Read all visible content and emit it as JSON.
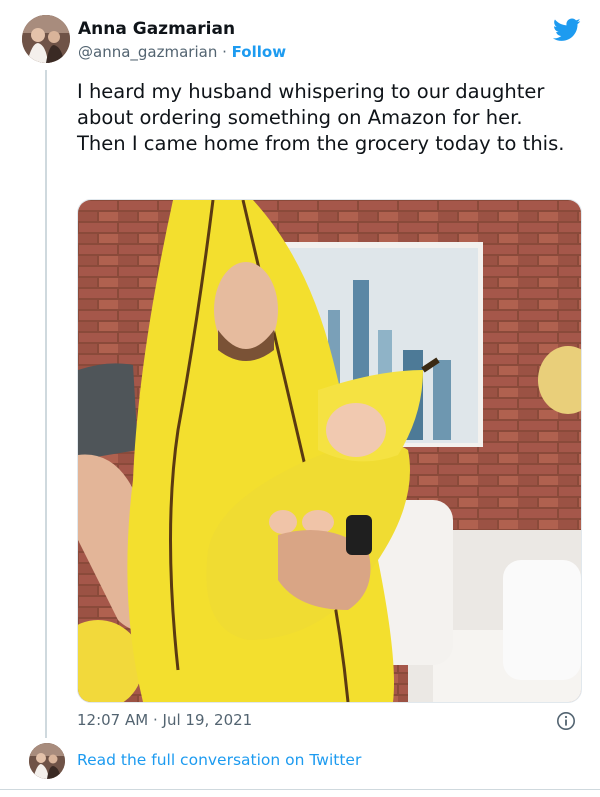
{
  "author": {
    "name": "Anna Gazmarian",
    "handle": "@anna_gazmarian",
    "separator": "·",
    "follow_label": "Follow"
  },
  "tweet": {
    "text": "I heard my husband whispering to our daughter about ordering something on Amazon for her. Then I came home from the grocery today to this.",
    "time": "12:07 AM",
    "date": "Jul 19, 2021"
  },
  "footer": {
    "read_label": "Read the full conversation on Twitter"
  },
  "icons": {
    "brand": "twitter-bird-icon",
    "info": "info-icon"
  },
  "colors": {
    "accent": "#1d9bf0",
    "text": "#0f1419",
    "muted": "#536471"
  }
}
